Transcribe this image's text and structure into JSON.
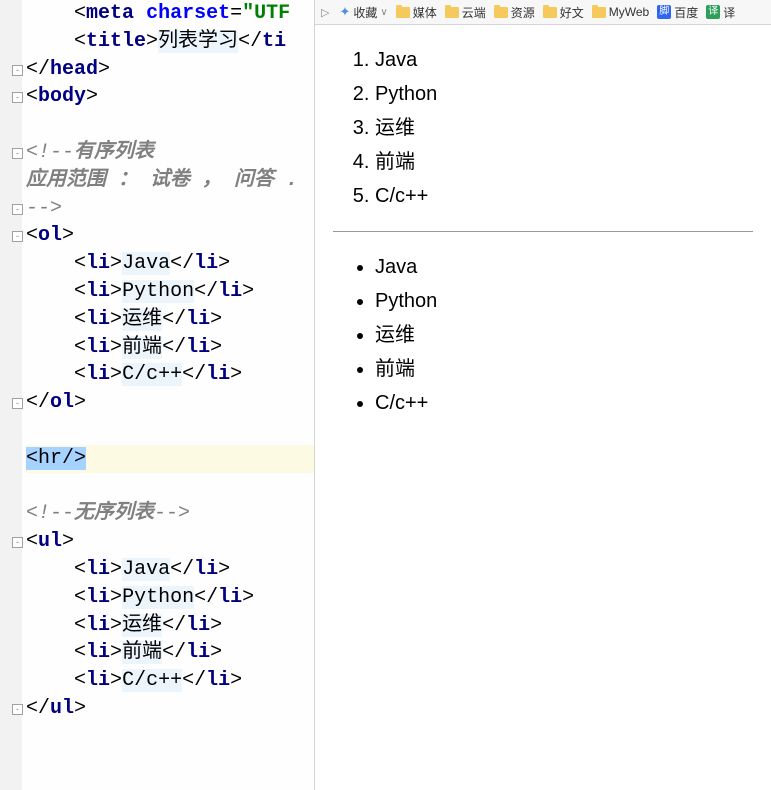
{
  "editor": {
    "lines": [
      {
        "indent": 4,
        "tokens": [
          {
            "t": "punct",
            "v": "<"
          },
          {
            "t": "tag",
            "v": "meta"
          },
          {
            "t": "punct",
            "v": " "
          },
          {
            "t": "attr",
            "v": "charset"
          },
          {
            "t": "punct",
            "v": "="
          },
          {
            "t": "attrval",
            "v": "\"UTF"
          }
        ]
      },
      {
        "indent": 4,
        "tokens": [
          {
            "t": "punct",
            "v": "<"
          },
          {
            "t": "tag",
            "v": "title"
          },
          {
            "t": "punct",
            "v": ">"
          },
          {
            "t": "txt",
            "v": "列表学习"
          },
          {
            "t": "punct",
            "v": "</"
          },
          {
            "t": "tag",
            "v": "ti"
          }
        ]
      },
      {
        "indent": 0,
        "fold": "-",
        "tokens": [
          {
            "t": "punct",
            "v": "</"
          },
          {
            "t": "tag",
            "v": "head"
          },
          {
            "t": "punct",
            "v": ">"
          }
        ]
      },
      {
        "indent": 0,
        "fold": "-",
        "tokens": [
          {
            "t": "punct",
            "v": "<"
          },
          {
            "t": "tag",
            "v": "body"
          },
          {
            "t": "punct",
            "v": ">"
          }
        ]
      },
      {
        "indent": 0,
        "tokens": []
      },
      {
        "indent": 0,
        "fold": "-",
        "tokens": [
          {
            "t": "comment",
            "v": "<!--"
          },
          {
            "t": "comment-bold",
            "v": "有序列表"
          }
        ]
      },
      {
        "indent": 0,
        "tokens": [
          {
            "t": "comment-bold",
            "v": "应用范围 ： 试卷 ， 问答 ."
          }
        ]
      },
      {
        "indent": 0,
        "fold": "-",
        "tokens": [
          {
            "t": "comment",
            "v": "-->"
          }
        ]
      },
      {
        "indent": 0,
        "fold": "-",
        "tokens": [
          {
            "t": "punct",
            "v": "<"
          },
          {
            "t": "tag",
            "v": "ol"
          },
          {
            "t": "punct",
            "v": ">"
          }
        ]
      },
      {
        "indent": 4,
        "tokens": [
          {
            "t": "punct",
            "v": "<"
          },
          {
            "t": "tag",
            "v": "li"
          },
          {
            "t": "punct",
            "v": ">"
          },
          {
            "t": "txt",
            "v": "Java"
          },
          {
            "t": "punct",
            "v": "</"
          },
          {
            "t": "tag",
            "v": "li"
          },
          {
            "t": "punct",
            "v": ">"
          }
        ]
      },
      {
        "indent": 4,
        "tokens": [
          {
            "t": "punct",
            "v": "<"
          },
          {
            "t": "tag",
            "v": "li"
          },
          {
            "t": "punct",
            "v": ">"
          },
          {
            "t": "txt",
            "v": "Python"
          },
          {
            "t": "punct",
            "v": "</"
          },
          {
            "t": "tag",
            "v": "li"
          },
          {
            "t": "punct",
            "v": ">"
          }
        ]
      },
      {
        "indent": 4,
        "tokens": [
          {
            "t": "punct",
            "v": "<"
          },
          {
            "t": "tag",
            "v": "li"
          },
          {
            "t": "punct",
            "v": ">"
          },
          {
            "t": "txt",
            "v": "运维"
          },
          {
            "t": "punct",
            "v": "</"
          },
          {
            "t": "tag",
            "v": "li"
          },
          {
            "t": "punct",
            "v": ">"
          }
        ]
      },
      {
        "indent": 4,
        "tokens": [
          {
            "t": "punct",
            "v": "<"
          },
          {
            "t": "tag",
            "v": "li"
          },
          {
            "t": "punct",
            "v": ">"
          },
          {
            "t": "txt",
            "v": "前端"
          },
          {
            "t": "punct",
            "v": "</"
          },
          {
            "t": "tag",
            "v": "li"
          },
          {
            "t": "punct",
            "v": ">"
          }
        ]
      },
      {
        "indent": 4,
        "tokens": [
          {
            "t": "punct",
            "v": "<"
          },
          {
            "t": "tag",
            "v": "li"
          },
          {
            "t": "punct",
            "v": ">"
          },
          {
            "t": "txt",
            "v": "C/c++"
          },
          {
            "t": "punct",
            "v": "</"
          },
          {
            "t": "tag",
            "v": "li"
          },
          {
            "t": "punct",
            "v": ">"
          }
        ]
      },
      {
        "indent": 0,
        "fold": "-",
        "tokens": [
          {
            "t": "punct",
            "v": "</"
          },
          {
            "t": "tag",
            "v": "ol"
          },
          {
            "t": "punct",
            "v": ">"
          }
        ]
      },
      {
        "indent": 0,
        "tokens": []
      },
      {
        "indent": 0,
        "highlight": true,
        "tokens": [
          {
            "t": "sel",
            "v": "<hr/>"
          }
        ]
      },
      {
        "indent": 0,
        "tokens": []
      },
      {
        "indent": 0,
        "tokens": [
          {
            "t": "comment",
            "v": "<!--"
          },
          {
            "t": "comment-bold",
            "v": "无序列表"
          },
          {
            "t": "comment",
            "v": "-->"
          }
        ]
      },
      {
        "indent": 0,
        "fold": "-",
        "tokens": [
          {
            "t": "punct",
            "v": "<"
          },
          {
            "t": "tag",
            "v": "ul"
          },
          {
            "t": "punct",
            "v": ">"
          }
        ]
      },
      {
        "indent": 4,
        "tokens": [
          {
            "t": "punct",
            "v": "<"
          },
          {
            "t": "tag",
            "v": "li"
          },
          {
            "t": "punct",
            "v": ">"
          },
          {
            "t": "txt",
            "v": "Java"
          },
          {
            "t": "punct",
            "v": "</"
          },
          {
            "t": "tag",
            "v": "li"
          },
          {
            "t": "punct",
            "v": ">"
          }
        ]
      },
      {
        "indent": 4,
        "tokens": [
          {
            "t": "punct",
            "v": "<"
          },
          {
            "t": "tag",
            "v": "li"
          },
          {
            "t": "punct",
            "v": ">"
          },
          {
            "t": "txt",
            "v": "Python"
          },
          {
            "t": "punct",
            "v": "</"
          },
          {
            "t": "tag",
            "v": "li"
          },
          {
            "t": "punct",
            "v": ">"
          }
        ]
      },
      {
        "indent": 4,
        "tokens": [
          {
            "t": "punct",
            "v": "<"
          },
          {
            "t": "tag",
            "v": "li"
          },
          {
            "t": "punct",
            "v": ">"
          },
          {
            "t": "txt",
            "v": "运维"
          },
          {
            "t": "punct",
            "v": "</"
          },
          {
            "t": "tag",
            "v": "li"
          },
          {
            "t": "punct",
            "v": ">"
          }
        ]
      },
      {
        "indent": 4,
        "tokens": [
          {
            "t": "punct",
            "v": "<"
          },
          {
            "t": "tag",
            "v": "li"
          },
          {
            "t": "punct",
            "v": ">"
          },
          {
            "t": "txt",
            "v": "前端"
          },
          {
            "t": "punct",
            "v": "</"
          },
          {
            "t": "tag",
            "v": "li"
          },
          {
            "t": "punct",
            "v": ">"
          }
        ]
      },
      {
        "indent": 4,
        "tokens": [
          {
            "t": "punct",
            "v": "<"
          },
          {
            "t": "tag",
            "v": "li"
          },
          {
            "t": "punct",
            "v": ">"
          },
          {
            "t": "txt",
            "v": "C/c++"
          },
          {
            "t": "punct",
            "v": "</"
          },
          {
            "t": "tag",
            "v": "li"
          },
          {
            "t": "punct",
            "v": ">"
          }
        ]
      },
      {
        "indent": 0,
        "fold": "-",
        "tokens": [
          {
            "t": "punct",
            "v": "</"
          },
          {
            "t": "tag",
            "v": "ul"
          },
          {
            "t": "punct",
            "v": ">"
          }
        ]
      },
      {
        "indent": 0,
        "tokens": []
      }
    ]
  },
  "bookmarks": {
    "nav_arrow": "▷",
    "items": [
      {
        "icon": "star",
        "label": "收藏",
        "sep": "∨"
      },
      {
        "icon": "folder",
        "label": "媒体"
      },
      {
        "icon": "folder",
        "label": "云端"
      },
      {
        "icon": "folder",
        "label": "资源"
      },
      {
        "icon": "folder",
        "label": "好文"
      },
      {
        "icon": "folder",
        "label": "MyWeb"
      },
      {
        "icon": "baidu",
        "label": "百度"
      },
      {
        "icon": "trans",
        "label": "译"
      }
    ]
  },
  "preview": {
    "ol": [
      "Java",
      "Python",
      "运维",
      "前端",
      "C/c++"
    ],
    "ul": [
      "Java",
      "Python",
      "运维",
      "前端",
      "C/c++"
    ]
  }
}
